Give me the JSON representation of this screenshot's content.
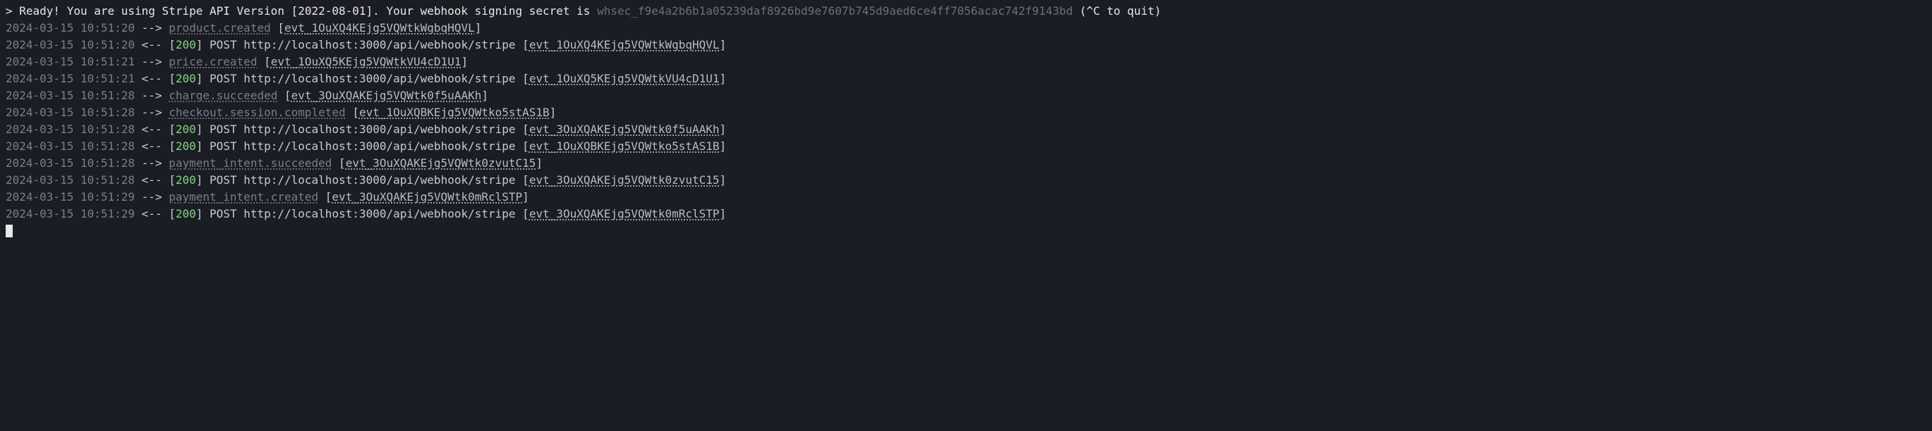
{
  "header": {
    "prompt": "> ",
    "ready_prefix": "Ready! You are using Stripe API Version [",
    "api_version": "2022-08-01",
    "ready_mid": "]. Your webhook signing secret is ",
    "secret": "whsec_f9e4a2b6b1a05239daf8926bd9e7607b745d9aed6ce4ff7056acac742f9143bd",
    "quit": " (^C to quit)"
  },
  "lines": [
    {
      "ts": "2024-03-15 10:51:20",
      "dir": "out",
      "event_type": "product.created",
      "event_id": "evt_1OuXQ4KEjg5VQWtkWgbqHQVL"
    },
    {
      "ts": "2024-03-15 10:51:20",
      "dir": "in",
      "status": "200",
      "method": "POST",
      "url": "http://localhost:3000/api/webhook/stripe",
      "event_id": "evt_1OuXQ4KEjg5VQWtkWgbqHQVL"
    },
    {
      "ts": "2024-03-15 10:51:21",
      "dir": "out",
      "event_type": "price.created",
      "event_id": "evt_1OuXQ5KEjg5VQWtkVU4cD1U1"
    },
    {
      "ts": "2024-03-15 10:51:21",
      "dir": "in",
      "status": "200",
      "method": "POST",
      "url": "http://localhost:3000/api/webhook/stripe",
      "event_id": "evt_1OuXQ5KEjg5VQWtkVU4cD1U1"
    },
    {
      "ts": "2024-03-15 10:51:28",
      "dir": "out",
      "event_type": "charge.succeeded",
      "event_id": "evt_3OuXQAKEjg5VQWtk0f5uAAKh"
    },
    {
      "ts": "2024-03-15 10:51:28",
      "dir": "out",
      "event_type": "checkout.session.completed",
      "event_id": "evt_1OuXQBKEjg5VQWtko5stAS1B"
    },
    {
      "ts": "2024-03-15 10:51:28",
      "dir": "in",
      "status": "200",
      "method": "POST",
      "url": "http://localhost:3000/api/webhook/stripe",
      "event_id": "evt_3OuXQAKEjg5VQWtk0f5uAAKh"
    },
    {
      "ts": "2024-03-15 10:51:28",
      "dir": "in",
      "status": "200",
      "method": "POST",
      "url": "http://localhost:3000/api/webhook/stripe",
      "event_id": "evt_1OuXQBKEjg5VQWtko5stAS1B"
    },
    {
      "ts": "2024-03-15 10:51:28",
      "dir": "out",
      "event_type": "payment_intent.succeeded",
      "event_id": "evt_3OuXQAKEjg5VQWtk0zvutC15"
    },
    {
      "ts": "2024-03-15 10:51:28",
      "dir": "in",
      "status": "200",
      "method": "POST",
      "url": "http://localhost:3000/api/webhook/stripe",
      "event_id": "evt_3OuXQAKEjg5VQWtk0zvutC15"
    },
    {
      "ts": "2024-03-15 10:51:29",
      "dir": "out",
      "event_type": "payment_intent.created",
      "event_id": "evt_3OuXQAKEjg5VQWtk0mRclSTP"
    },
    {
      "ts": "2024-03-15 10:51:29",
      "dir": "in",
      "status": "200",
      "method": "POST",
      "url": "http://localhost:3000/api/webhook/stripe",
      "event_id": "evt_3OuXQAKEjg5VQWtk0mRclSTP"
    }
  ],
  "arrows": {
    "out": "-->",
    "in": "<--"
  }
}
